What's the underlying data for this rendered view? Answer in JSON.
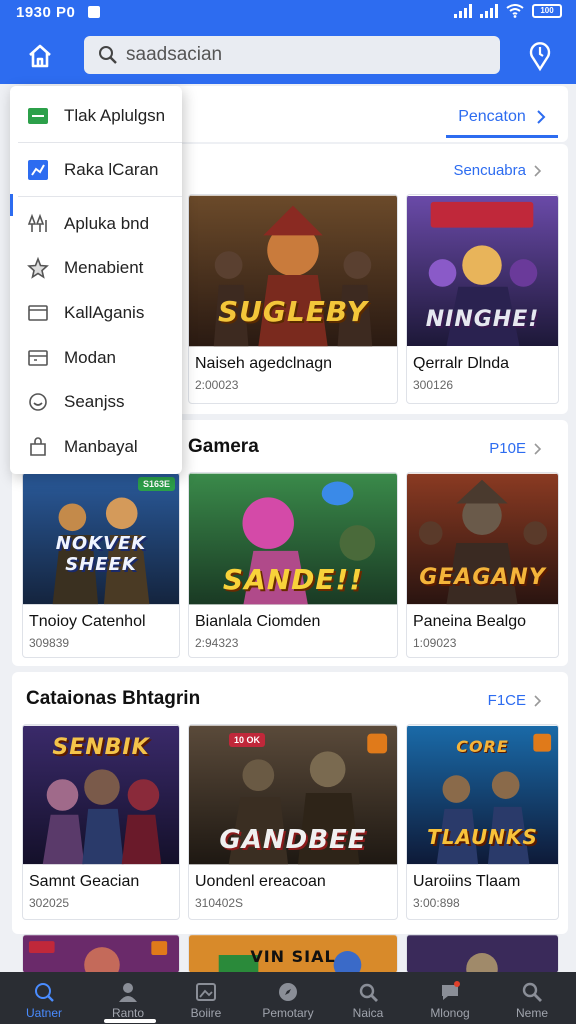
{
  "status": {
    "time": "1930 P0",
    "battery": "100"
  },
  "search": {
    "placeholder": "saadsacian"
  },
  "tab_link": "Pencaton",
  "drawer": [
    {
      "label": "Tlak Aplulgsn",
      "icon": "app-icon"
    },
    {
      "label": "Raka lCaran",
      "icon": "chart-icon"
    },
    {
      "label": "Apluka bnd",
      "icon": "trees-icon"
    },
    {
      "label": "Menabient",
      "icon": "star-icon"
    },
    {
      "label": "KallAganis",
      "icon": "window-icon"
    },
    {
      "label": "Modan",
      "icon": "calendar-icon"
    },
    {
      "label": "Seanjss",
      "icon": "smile-icon"
    },
    {
      "label": "Manbayal",
      "icon": "bag-icon"
    }
  ],
  "sections": [
    {
      "title": "",
      "link": "Sencuabra",
      "items": [
        {
          "title": "Naiseh agedclnagn",
          "sub": "2:00023",
          "art": "SUGLEBY"
        },
        {
          "title": "Qerralr Dlnda",
          "sub": "300126",
          "art": "NINGHE!"
        }
      ]
    },
    {
      "title": "Gamera",
      "link": "P10E",
      "items": [
        {
          "title": "Tnoioy Catenhol",
          "sub": "309839",
          "art": "NOKVEK SHEEK",
          "badge": "S163E"
        },
        {
          "title": "Bianlala Ciomden",
          "sub": "2:94323",
          "art": "SANDE!!"
        },
        {
          "title": "Paneina Bealgo",
          "sub": "1:09023",
          "art": "GEAGANY"
        }
      ]
    },
    {
      "title": "Cataionas Bhtagrin",
      "link": "F1CE",
      "items": [
        {
          "title": "Samnt Geacian",
          "sub": "302025",
          "art": "SENBIK"
        },
        {
          "title": "Uondenl ereacoan",
          "sub": "310402S",
          "art": "GANDBEE",
          "badge": "10 OK"
        },
        {
          "title": "Uaroiins Tlaam",
          "sub": "3:00:898",
          "art": "TLAUNKS",
          "art_top": "CORE"
        }
      ]
    }
  ],
  "row4_arts": [
    "",
    "VIN SIAL",
    "",
    ""
  ],
  "nav": [
    {
      "label": "Uatner",
      "icon": "search-icon",
      "active": true
    },
    {
      "label": "Ranto",
      "icon": "person-icon"
    },
    {
      "label": "Boiire",
      "icon": "image-icon"
    },
    {
      "label": "Pemotary",
      "icon": "compass-icon"
    },
    {
      "label": "Naica",
      "icon": "magnify-icon"
    },
    {
      "label": "Mlonog",
      "icon": "chat-icon"
    },
    {
      "label": "Neme",
      "icon": "zoom-icon"
    }
  ],
  "colors": {
    "primary": "#2d6cf0",
    "nav_bg": "#2a2d33",
    "active_nav": "#4a8cff"
  }
}
